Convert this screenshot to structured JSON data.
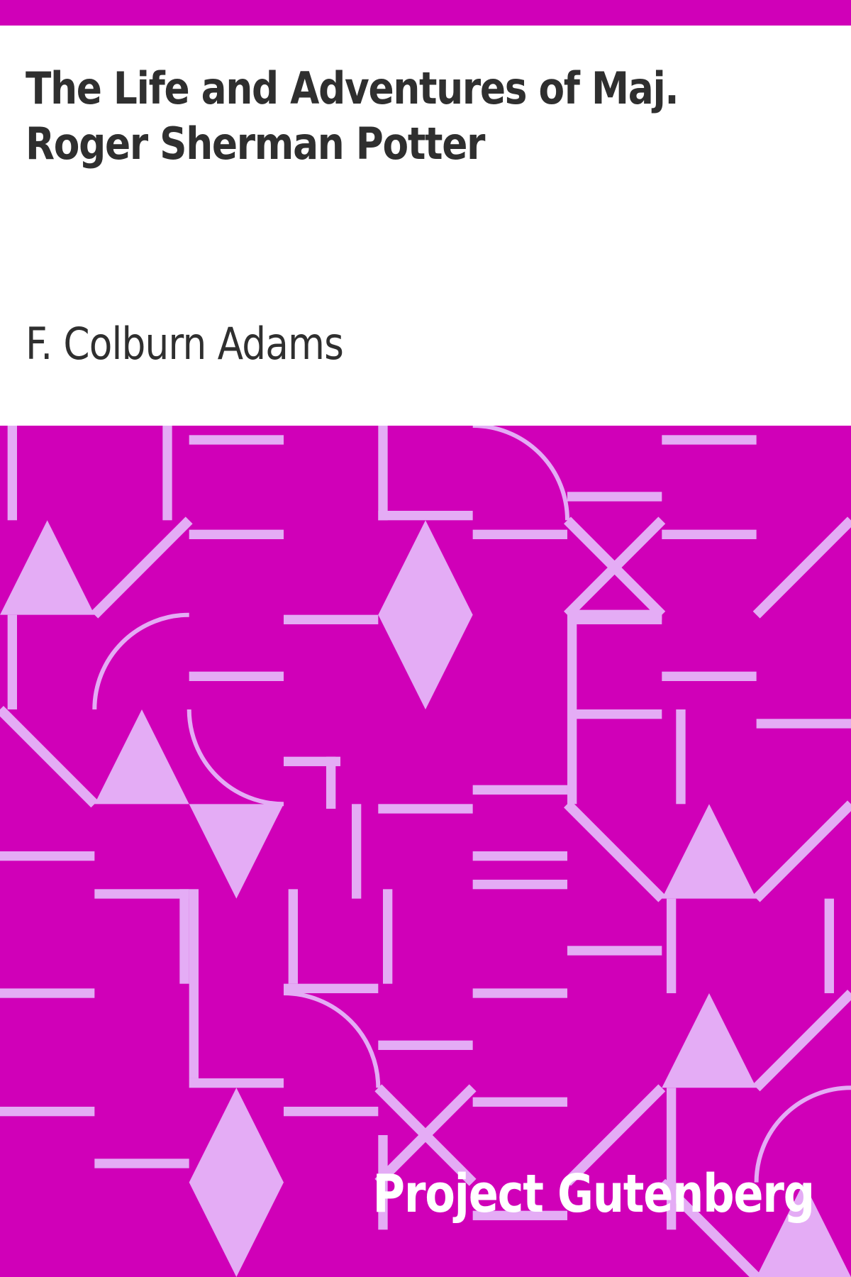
{
  "book": {
    "title": "The Life and Adventures of Maj. Roger Sherman Potter",
    "author": "F. Colburn Adams",
    "publisher": "Project Gutenberg"
  },
  "colors": {
    "background": "#d000b8",
    "pattern": "#e4acf5",
    "header_background": "#ffffff",
    "title_text": "#2f2f2f",
    "publisher_text": "#ffffff"
  },
  "pattern": {
    "motifs": [
      "vertical-bar",
      "horizontal-bar",
      "triangle",
      "diamond",
      "quarter-arc",
      "x-cross",
      "diagonal-line"
    ]
  }
}
